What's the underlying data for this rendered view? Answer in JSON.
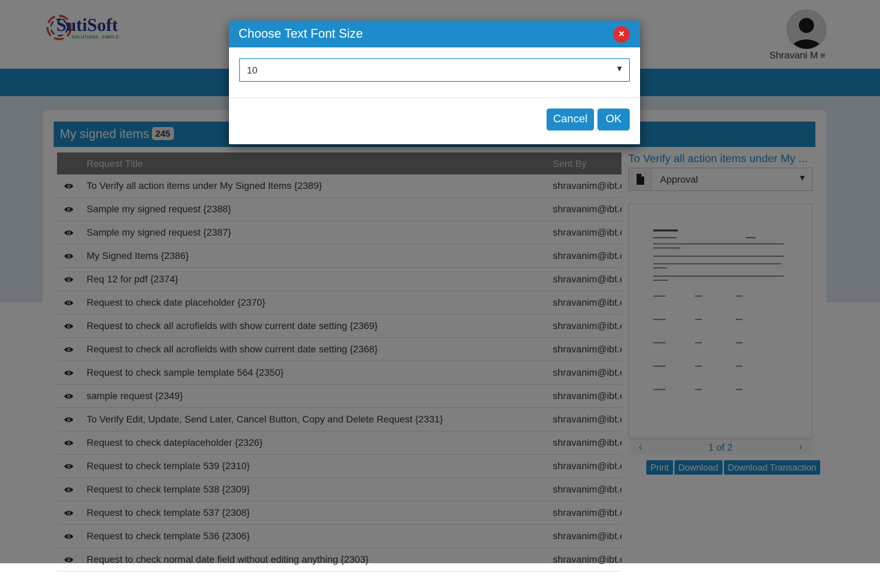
{
  "header": {
    "logo_text": "SutiSoft",
    "logo_tagline": "SOLUTIONS. SIMPLE.",
    "user_name": "Shravani M",
    "menu_icon": "hamburger-icon"
  },
  "card": {
    "title": "My signed items",
    "count": "245"
  },
  "table": {
    "columns": [
      "Request Title",
      "Sent By"
    ],
    "rows": [
      {
        "title": "To Verify all action items under My Signed Items {2389}",
        "sent_by": "shravanim@ibt.e"
      },
      {
        "title": "Sample my signed request {2388}",
        "sent_by": "shravanim@ibt.e"
      },
      {
        "title": "Sample my signed request {2387}",
        "sent_by": "shravanim@ibt.e"
      },
      {
        "title": "My Signed Items {2386}",
        "sent_by": "shravanim@ibt.e"
      },
      {
        "title": "Req 12 for pdf {2374}",
        "sent_by": "shravanim@ibt.e"
      },
      {
        "title": "Request to check date placeholder {2370}",
        "sent_by": "shravanim@ibt.e"
      },
      {
        "title": "Request to check all acrofields with show current date setting {2369}",
        "sent_by": "shravanim@ibt.e"
      },
      {
        "title": "Request to check all acrofields with show current date setting {2368}",
        "sent_by": "shravanim@ibt.e"
      },
      {
        "title": "Request to check sample template 564 {2350}",
        "sent_by": "shravanim@ibt.e"
      },
      {
        "title": "sample request {2349}",
        "sent_by": "shravanim@ibt.e"
      },
      {
        "title": "To Verify Edit, Update, Send Later, Cancel Button, Copy and Delete Request {2331}",
        "sent_by": "shravanim@ibt.e"
      },
      {
        "title": "Request to check dateplaceholder {2326}",
        "sent_by": "shravanim@ibt.e"
      },
      {
        "title": "Request to check template 539 {2310}",
        "sent_by": "shravanim@ibt.e"
      },
      {
        "title": "Request to check template 538 {2309}",
        "sent_by": "shravanim@ibt.e"
      },
      {
        "title": "Request to check template 537 {2308}",
        "sent_by": "shravanim@ibt.e"
      },
      {
        "title": "Request to check template 536 {2306}",
        "sent_by": "shravanim@ibt.e"
      },
      {
        "title": "Request to check normal date field without editing anything {2303}",
        "sent_by": "shravanim@ibt.e"
      }
    ]
  },
  "side": {
    "title": "To Verify all action items under My ...",
    "document_select": "Approval",
    "pager": "1 of 2",
    "prev": "‹",
    "next": "›",
    "buttons": [
      "Print",
      "Download",
      "Download Transaction"
    ]
  },
  "modal": {
    "title": "Choose Text Font Size",
    "close": "×",
    "font_size_value": "10",
    "cancel_label": "Cancel",
    "ok_label": "OK"
  },
  "colors": {
    "brand_blue": "#1e8ccb",
    "close_red": "#e02d2d"
  }
}
